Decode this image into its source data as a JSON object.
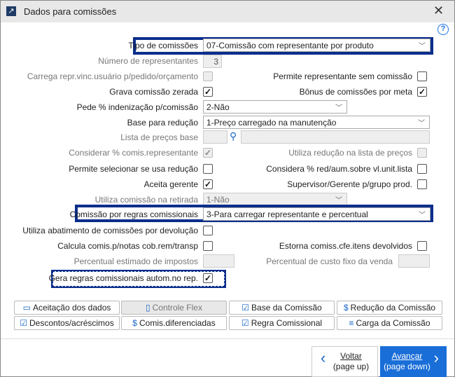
{
  "window": {
    "title": "Dados para comissões",
    "close": "✕",
    "help": "?"
  },
  "form": {
    "tipo_label": "Tipo de comissões",
    "tipo_value": "07-Comissão com representante por produto",
    "num_label": "Número de representantes",
    "num_value": "3",
    "carrega_label": "Carrega repr.vinc.usuário p/pedido/orçamento",
    "permite_sem_label": "Permite representante sem comissão",
    "grava_label": "Grava comissão zerada",
    "bonus_label": "Bônus de comissões por meta",
    "pede_label": "Pede % indenização p/comissão",
    "pede_value": "2-Não",
    "base_label": "Base para redução",
    "base_value": "1-Preço carregado na manutenção",
    "lista_label": "Lista de preços base",
    "considerar_label": "Considerar % comis.representante",
    "utiliza_red_label": "Utiliza redução na lista de preços",
    "permite_sel_label": "Permite selecionar se usa redução",
    "considera_red_label": "Considera % red/aum.sobre vl.unit.lista",
    "aceita_label": "Aceita gerente",
    "supervisor_label": "Supervisor/Gerente p/grupo prod.",
    "retirada_label": "Utiliza comissão na retirada",
    "retirada_value": "1-Não",
    "regras_label": "Comissão por regras comissionais",
    "regras_value": "3-Para carregar representante e percentual",
    "abat_label": "Utiliza abatimento de comissões por devolução",
    "calcula_label": "Calcula comis.p/notas cob.rem/transp",
    "estorna_label": "Estorna comiss.cfe.itens devolvidos",
    "percentual_label": "Percentual estimado de impostos",
    "custo_label": "Percentual de custo fixo da venda",
    "gera_label": "Gera regras comissionais autom.no rep.",
    "check": "✓"
  },
  "buttons": [
    {
      "label": "Aceitação dos dados",
      "icon": "▭"
    },
    {
      "label": "Controle Flex",
      "icon": "▯"
    },
    {
      "label": "Base da Comissão",
      "icon": "☑"
    },
    {
      "label": "Redução da Comissão",
      "icon": "$"
    },
    {
      "label": "Descontos/acréscimos",
      "icon": "☑"
    },
    {
      "label": "Comis.diferenciadas",
      "icon": "$"
    },
    {
      "label": "Regra Comissional",
      "icon": "☑"
    },
    {
      "label": "Carga da Comissão",
      "icon": "≡"
    }
  ],
  "nav": {
    "back_label": "Voltar",
    "back_sub": "(page up)",
    "next_label": "Avançar",
    "next_sub": "(page down)",
    "back_icon": "‹",
    "next_icon": "›"
  }
}
